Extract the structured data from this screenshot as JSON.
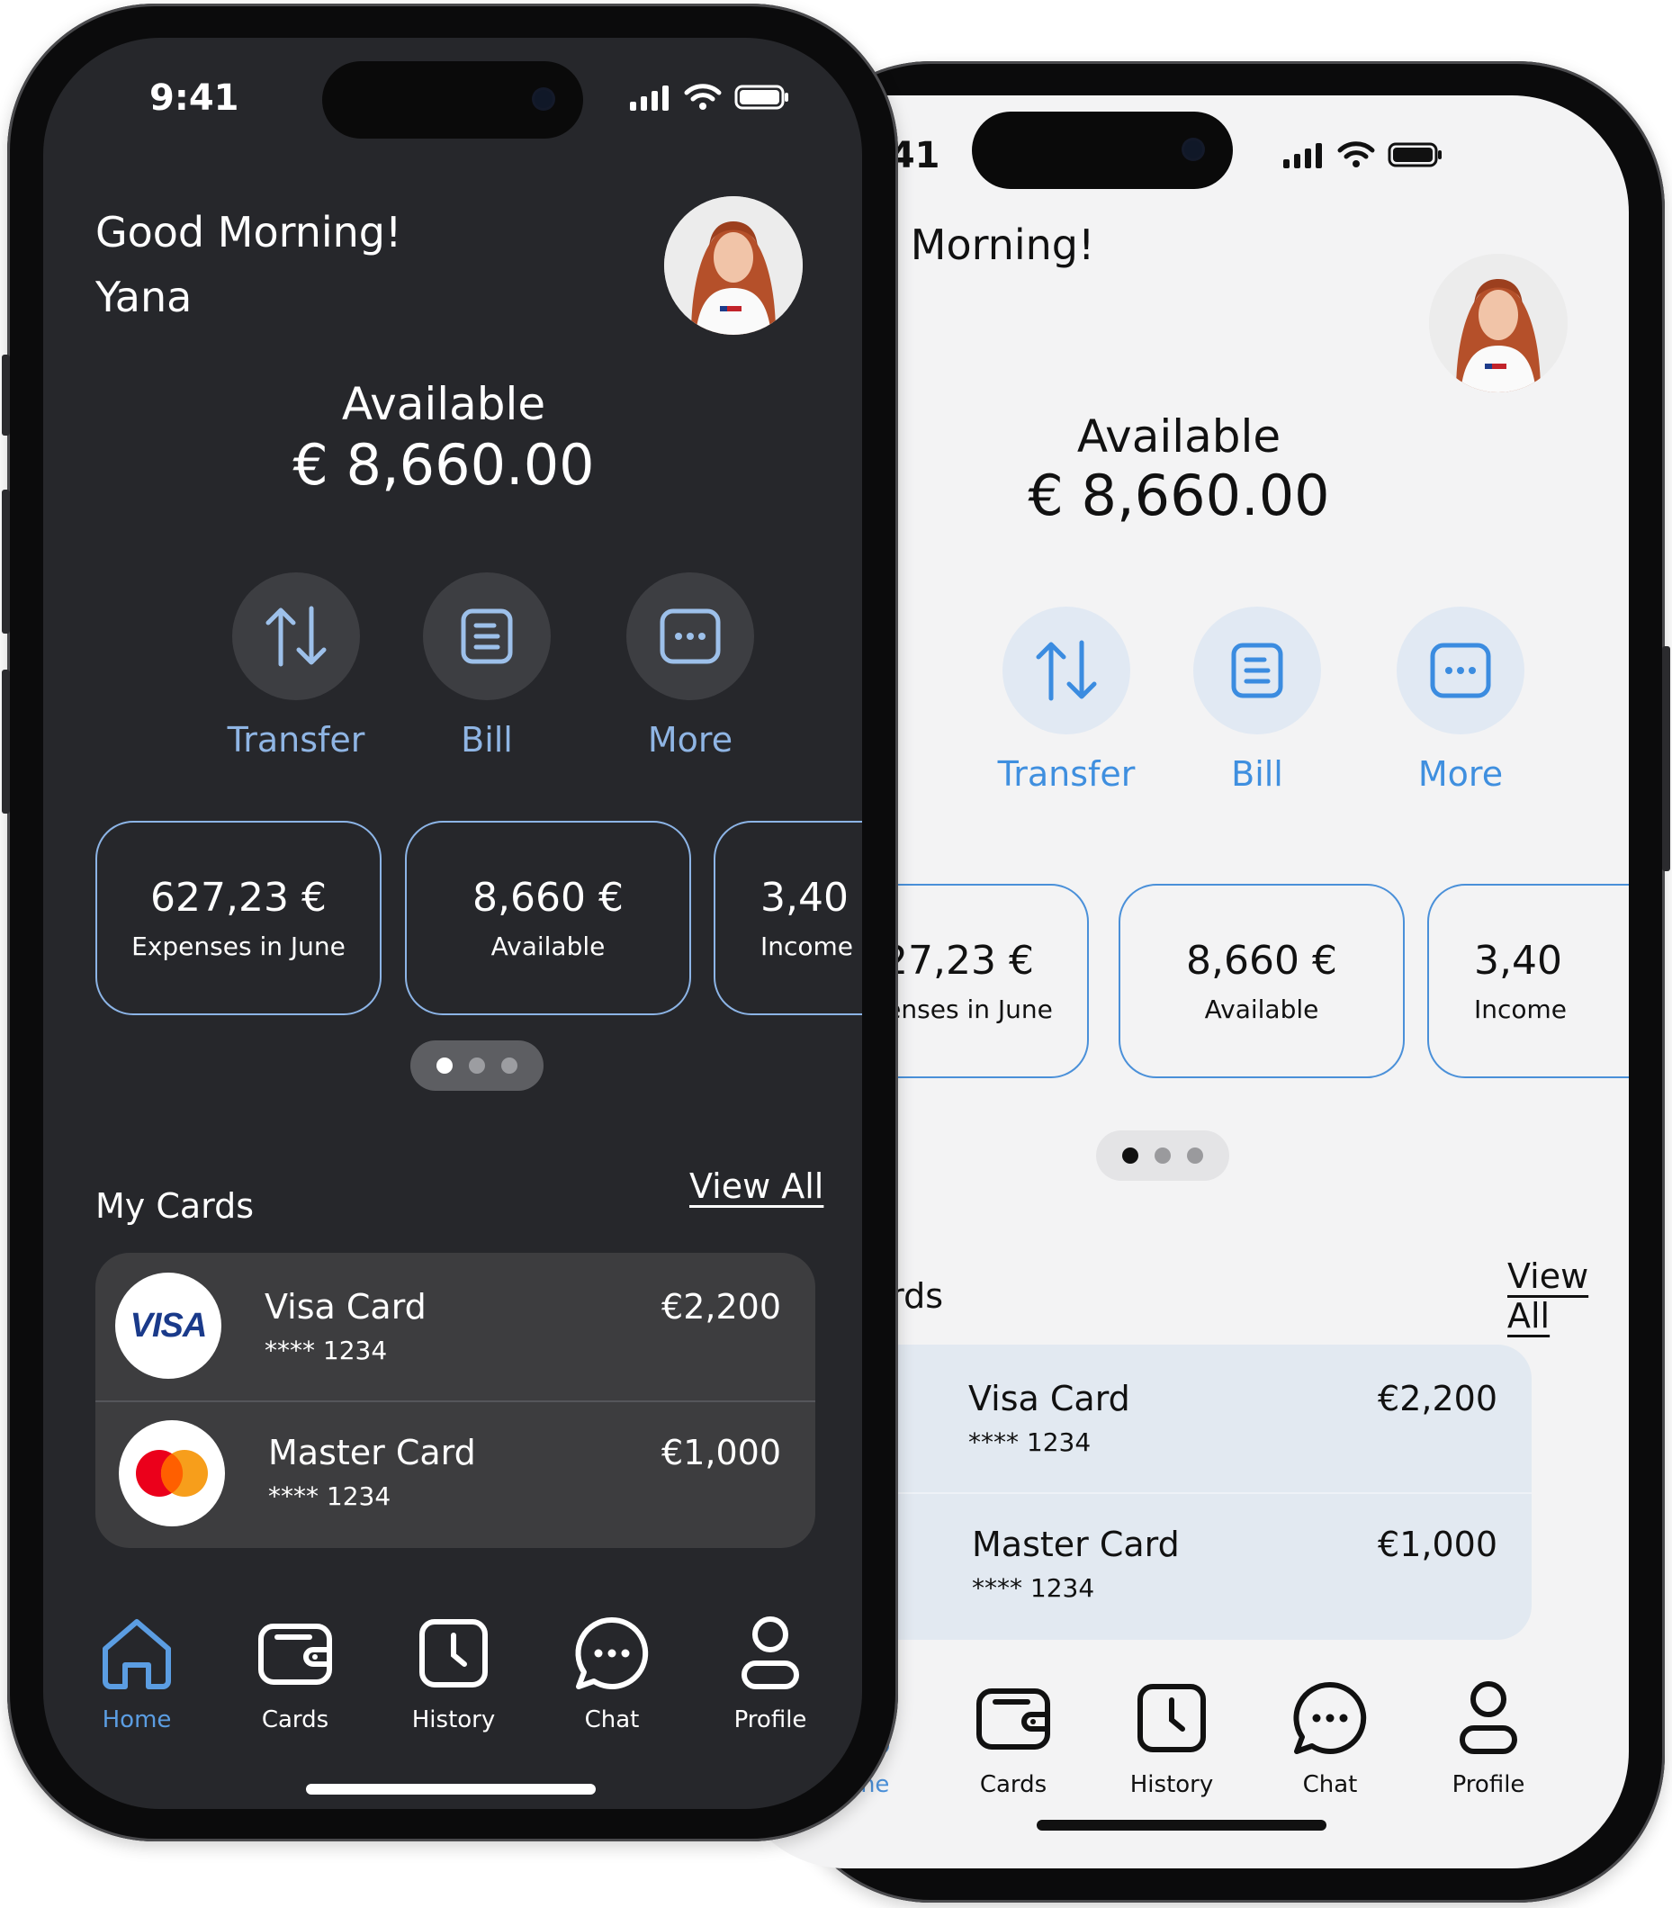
{
  "status": {
    "time": "9:41"
  },
  "greeting": {
    "line1": "Good Morning!",
    "line2": "Yana"
  },
  "balance": {
    "title": "Available",
    "amount": "€ 8,660.00"
  },
  "actions": [
    {
      "label": "Transfer",
      "icon": "transfer-arrows-icon"
    },
    {
      "label": "Bill",
      "icon": "bill-icon"
    },
    {
      "label": "More",
      "icon": "more-dots-icon"
    }
  ],
  "stats": [
    {
      "value": "627,23 €",
      "label": "Expenses in June"
    },
    {
      "value": "8,660 €",
      "label": "Available"
    },
    {
      "value": "3,40",
      "label": "Income"
    }
  ],
  "my_cards": {
    "title": "My Cards",
    "view_all": "View All",
    "items": [
      {
        "name": "Visa Card",
        "number": "**** 1234",
        "balance": "€2,200",
        "brand": "VISA"
      },
      {
        "name": "Master Card",
        "number": "**** 1234",
        "balance": "€1,000",
        "brand": "mastercard"
      }
    ]
  },
  "nav": [
    {
      "label": "Home",
      "icon": "home-icon",
      "active": true
    },
    {
      "label": "Cards",
      "icon": "wallet-icon"
    },
    {
      "label": "History",
      "icon": "clock-icon"
    },
    {
      "label": "Chat",
      "icon": "chat-bubble-icon"
    },
    {
      "label": "Profile",
      "icon": "user-icon"
    }
  ],
  "colors": {
    "accent": "#5b9de2",
    "dark_bg": "#26272b",
    "light_bg": "#f3f3f4"
  }
}
